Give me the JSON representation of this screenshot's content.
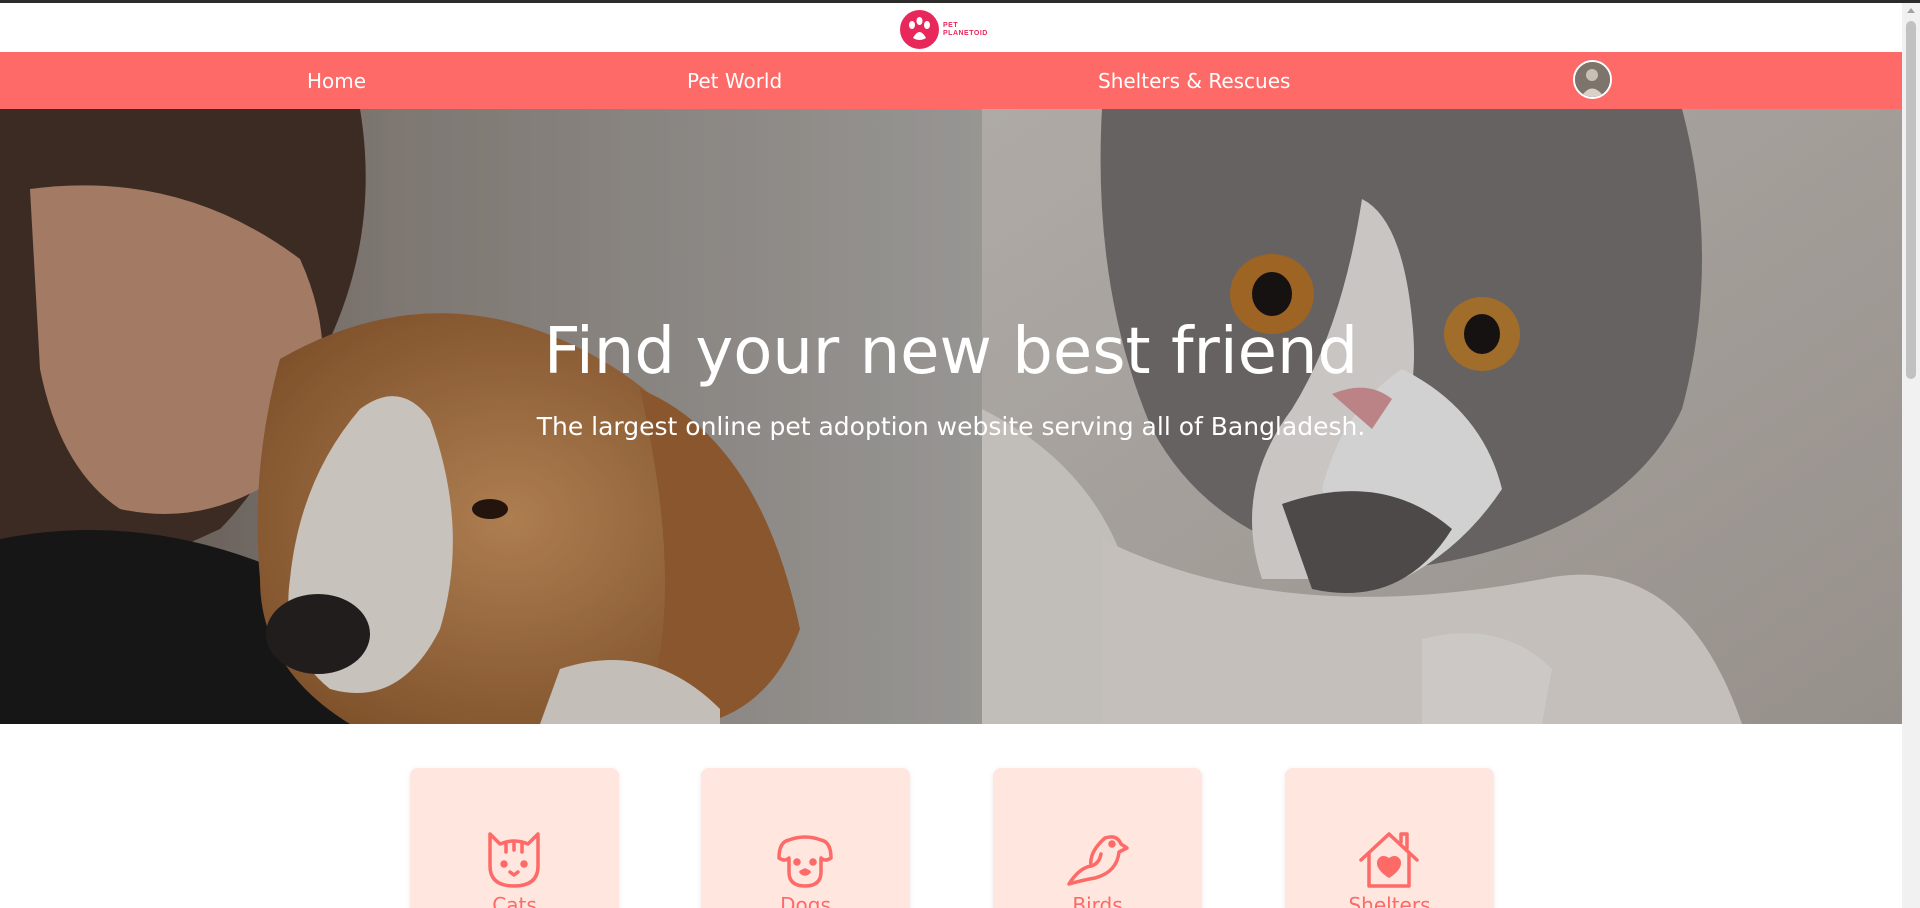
{
  "logo": {
    "line1": "PET",
    "line2": "PLANETOID"
  },
  "nav": {
    "items": [
      {
        "label": "Home"
      },
      {
        "label": "Pet World"
      },
      {
        "label": "Shelters & Rescues"
      }
    ]
  },
  "hero": {
    "title": "Find your new best friend",
    "subtitle": "The largest online pet adoption website serving all of Bangladesh."
  },
  "cards": [
    {
      "label": "Cats",
      "icon": "cat-icon"
    },
    {
      "label": "Dogs",
      "icon": "dog-icon"
    },
    {
      "label": "Birds",
      "icon": "bird-icon"
    },
    {
      "label": "Shelters",
      "icon": "shelter-house-heart-icon"
    }
  ],
  "colors": {
    "nav_bg": "#fd6a67",
    "brand": "#e8285a",
    "card_bg": "#ffe6de",
    "accent": "#fd6a67"
  }
}
